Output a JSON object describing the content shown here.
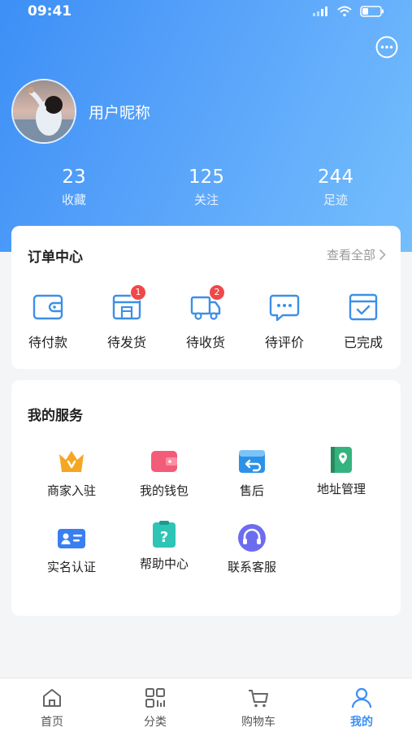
{
  "status_bar": {
    "time": "09:41"
  },
  "profile": {
    "nickname": "用户昵称"
  },
  "stats": [
    {
      "value": "23",
      "label": "收藏"
    },
    {
      "value": "125",
      "label": "关注"
    },
    {
      "value": "244",
      "label": "足迹"
    }
  ],
  "orders": {
    "title": "订单中心",
    "view_all": "查看全部",
    "items": [
      {
        "label": "待付款",
        "icon": "wallet-icon"
      },
      {
        "label": "待发货",
        "icon": "shop-box-icon",
        "badge": "1"
      },
      {
        "label": "待收货",
        "icon": "truck-icon",
        "badge": "2"
      },
      {
        "label": "待评价",
        "icon": "comment-icon"
      },
      {
        "label": "已完成",
        "icon": "check-calendar-icon"
      }
    ]
  },
  "services": {
    "title": "我的服务",
    "items": [
      {
        "label": "商家入驻",
        "icon": "crown-icon"
      },
      {
        "label": "我的钱包",
        "icon": "wallet-icon"
      },
      {
        "label": "售后",
        "icon": "return-icon"
      },
      {
        "label": "地址管理",
        "icon": "address-book-icon"
      },
      {
        "label": "实名认证",
        "icon": "id-card-icon"
      },
      {
        "label": "帮助中心",
        "icon": "help-icon"
      },
      {
        "label": "联系客服",
        "icon": "headset-icon"
      }
    ]
  },
  "tabbar": {
    "items": [
      {
        "label": "首页",
        "icon": "home-icon"
      },
      {
        "label": "分类",
        "icon": "category-icon"
      },
      {
        "label": "购物车",
        "icon": "cart-icon"
      },
      {
        "label": "我的",
        "icon": "user-icon",
        "active": true
      }
    ]
  },
  "colors": {
    "primary": "#3a8ff5",
    "badge": "#f04848",
    "order_icon": "#3d8fe6"
  }
}
